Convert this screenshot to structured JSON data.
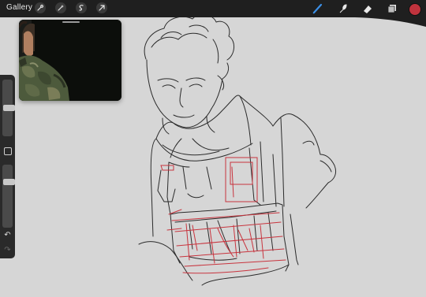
{
  "topbar": {
    "gallery_label": "Gallery",
    "left_tools": [
      "wrench-icon",
      "magic-wand-icon",
      "selection-icon",
      "transform-arrow-icon"
    ],
    "right_tools": [
      "brush-icon",
      "smudge-icon",
      "eraser-icon",
      "layers-icon"
    ],
    "color": "#c0333d"
  },
  "reference_window": {
    "title": ""
  },
  "sidebar": {
    "brush_size_level": 0.5,
    "opacity_level": 0.75,
    "undo_icon": "undo-icon",
    "redo_icon": "redo-icon"
  },
  "colors": {
    "canvas": "#d6d6d6",
    "sketch_red": "#c8343e",
    "ink": "#2b2b2b"
  }
}
